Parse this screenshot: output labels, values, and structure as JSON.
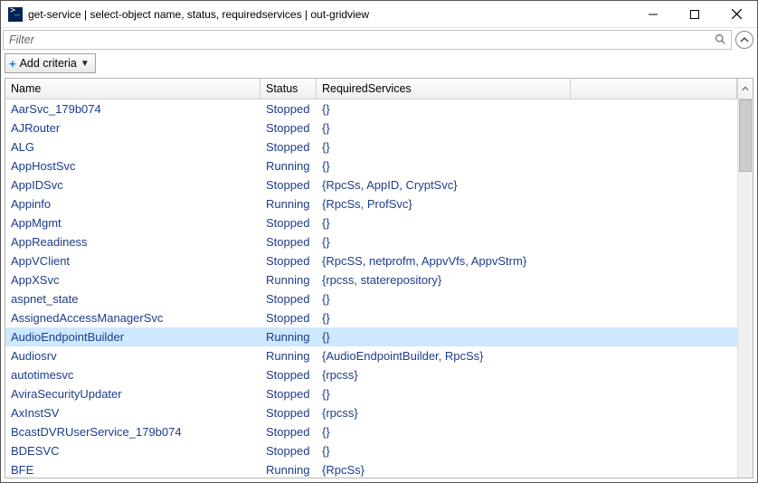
{
  "window": {
    "title": "get-service | select-object name, status, requiredservices | out-gridview"
  },
  "filter": {
    "placeholder": "Filter",
    "value": ""
  },
  "criteria": {
    "add_label": "Add criteria"
  },
  "columns": {
    "name": "Name",
    "status": "Status",
    "required": "RequiredServices"
  },
  "selected_index": 12,
  "rows": [
    {
      "name": "AarSvc_179b074",
      "status": "Stopped",
      "required": "{}"
    },
    {
      "name": "AJRouter",
      "status": "Stopped",
      "required": "{}"
    },
    {
      "name": "ALG",
      "status": "Stopped",
      "required": "{}"
    },
    {
      "name": "AppHostSvc",
      "status": "Running",
      "required": "{}"
    },
    {
      "name": "AppIDSvc",
      "status": "Stopped",
      "required": "{RpcSs, AppID, CryptSvc}"
    },
    {
      "name": "Appinfo",
      "status": "Running",
      "required": "{RpcSs, ProfSvc}"
    },
    {
      "name": "AppMgmt",
      "status": "Stopped",
      "required": "{}"
    },
    {
      "name": "AppReadiness",
      "status": "Stopped",
      "required": "{}"
    },
    {
      "name": "AppVClient",
      "status": "Stopped",
      "required": "{RpcSS, netprofm, AppvVfs, AppvStrm}"
    },
    {
      "name": "AppXSvc",
      "status": "Running",
      "required": "{rpcss, staterepository}"
    },
    {
      "name": "aspnet_state",
      "status": "Stopped",
      "required": "{}"
    },
    {
      "name": "AssignedAccessManagerSvc",
      "status": "Stopped",
      "required": "{}"
    },
    {
      "name": "AudioEndpointBuilder",
      "status": "Running",
      "required": "{}"
    },
    {
      "name": "Audiosrv",
      "status": "Running",
      "required": "{AudioEndpointBuilder, RpcSs}"
    },
    {
      "name": "autotimesvc",
      "status": "Stopped",
      "required": "{rpcss}"
    },
    {
      "name": "AviraSecurityUpdater",
      "status": "Stopped",
      "required": "{}"
    },
    {
      "name": "AxInstSV",
      "status": "Stopped",
      "required": "{rpcss}"
    },
    {
      "name": "BcastDVRUserService_179b074",
      "status": "Stopped",
      "required": "{}"
    },
    {
      "name": "BDESVC",
      "status": "Stopped",
      "required": "{}"
    },
    {
      "name": "BFE",
      "status": "Running",
      "required": "{RpcSs}"
    }
  ]
}
